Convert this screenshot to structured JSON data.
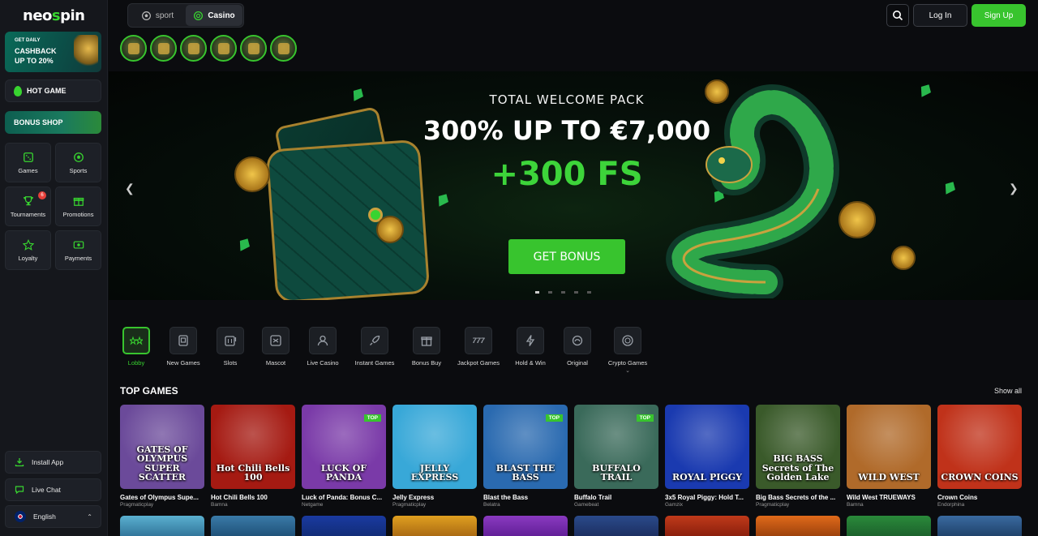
{
  "brand": {
    "logo": "neospin",
    "accent": "#38c42e"
  },
  "sidebar": {
    "cashback": {
      "line1": "GET DAILY",
      "line2": "CASHBACK",
      "line3": "UP TO 20%"
    },
    "hot_game": "HOT GAME",
    "bonus_shop": "BONUS SHOP",
    "nav": [
      {
        "label": "Games",
        "icon": "dice-icon"
      },
      {
        "label": "Sports",
        "icon": "soccer-ball-icon"
      },
      {
        "label": "Tournaments",
        "icon": "trophy-icon",
        "badge": "6"
      },
      {
        "label": "Promotions",
        "icon": "gift-icon"
      },
      {
        "label": "Loyalty",
        "icon": "star-icon"
      },
      {
        "label": "Payments",
        "icon": "wallet-icon"
      }
    ],
    "install_app": "Install App",
    "live_chat": "Live Chat",
    "language": "English"
  },
  "topbar": {
    "tabs": [
      {
        "label": "sport",
        "active": false
      },
      {
        "label": "Casino",
        "active": true
      }
    ],
    "login": "Log In",
    "signup": "Sign Up"
  },
  "banner": {
    "line1": "TOTAL WELCOME PACK",
    "line2": "300% UP TO €7,000",
    "line3": "+300 FS",
    "cta": "GET BONUS",
    "slides": 5,
    "active_slide": 1
  },
  "categories": [
    {
      "label": "Lobby",
      "active": true
    },
    {
      "label": "New Games"
    },
    {
      "label": "Slots"
    },
    {
      "label": "Mascot"
    },
    {
      "label": "Live Casino"
    },
    {
      "label": "Instant Games"
    },
    {
      "label": "Bonus Buy"
    },
    {
      "label": "Jackpot Games"
    },
    {
      "label": "Hold & Win"
    },
    {
      "label": "Original"
    },
    {
      "label": "Crypto Games"
    }
  ],
  "top_games": {
    "title": "TOP GAMES",
    "show_all": "Show all",
    "items": [
      {
        "name": "Gates of Olympus Supe...",
        "provider": "Pragmaticplay",
        "art": "GATES OF OLYMPUS SUPER SCATTER",
        "top": false,
        "bg": "#6b4a9a"
      },
      {
        "name": "Hot Chili Bells 100",
        "provider": "Bamna",
        "art": "Hot Chili Bells 100",
        "top": false,
        "bg": "#a51a12"
      },
      {
        "name": "Luck of Panda: Bonus C...",
        "provider": "Netgame",
        "art": "LUCK OF PANDA",
        "top": true,
        "bg": "#7a3aa8"
      },
      {
        "name": "Jelly Express",
        "provider": "Pragmaticplay",
        "art": "JELLY EXPRESS",
        "top": false,
        "bg": "#38a8d8"
      },
      {
        "name": "Blast the Bass",
        "provider": "Belatra",
        "art": "BLAST THE BASS",
        "top": true,
        "bg": "#2a6ab0"
      },
      {
        "name": "Buffalo Trail",
        "provider": "Gamebeat",
        "art": "BUFFALO TRAIL",
        "top": true,
        "bg": "#3a6a5a"
      },
      {
        "name": "3x5 Royal Piggy: Hold T...",
        "provider": "Gamzix",
        "art": "ROYAL PIGGY",
        "top": false,
        "bg": "#1a3ab0"
      },
      {
        "name": "Big Bass Secrets of the ...",
        "provider": "Pragmaticplay",
        "art": "BIG BASS Secrets of The Golden Lake",
        "top": false,
        "bg": "#3a5a2a"
      },
      {
        "name": "Wild West TRUEWAYS",
        "provider": "Bamna",
        "art": "WILD WEST",
        "top": false,
        "bg": "#b06a2a"
      },
      {
        "name": "Crown Coins",
        "provider": "Endorphina",
        "art": "CROWN COINS",
        "top": false,
        "bg": "#c0321a"
      }
    ]
  }
}
